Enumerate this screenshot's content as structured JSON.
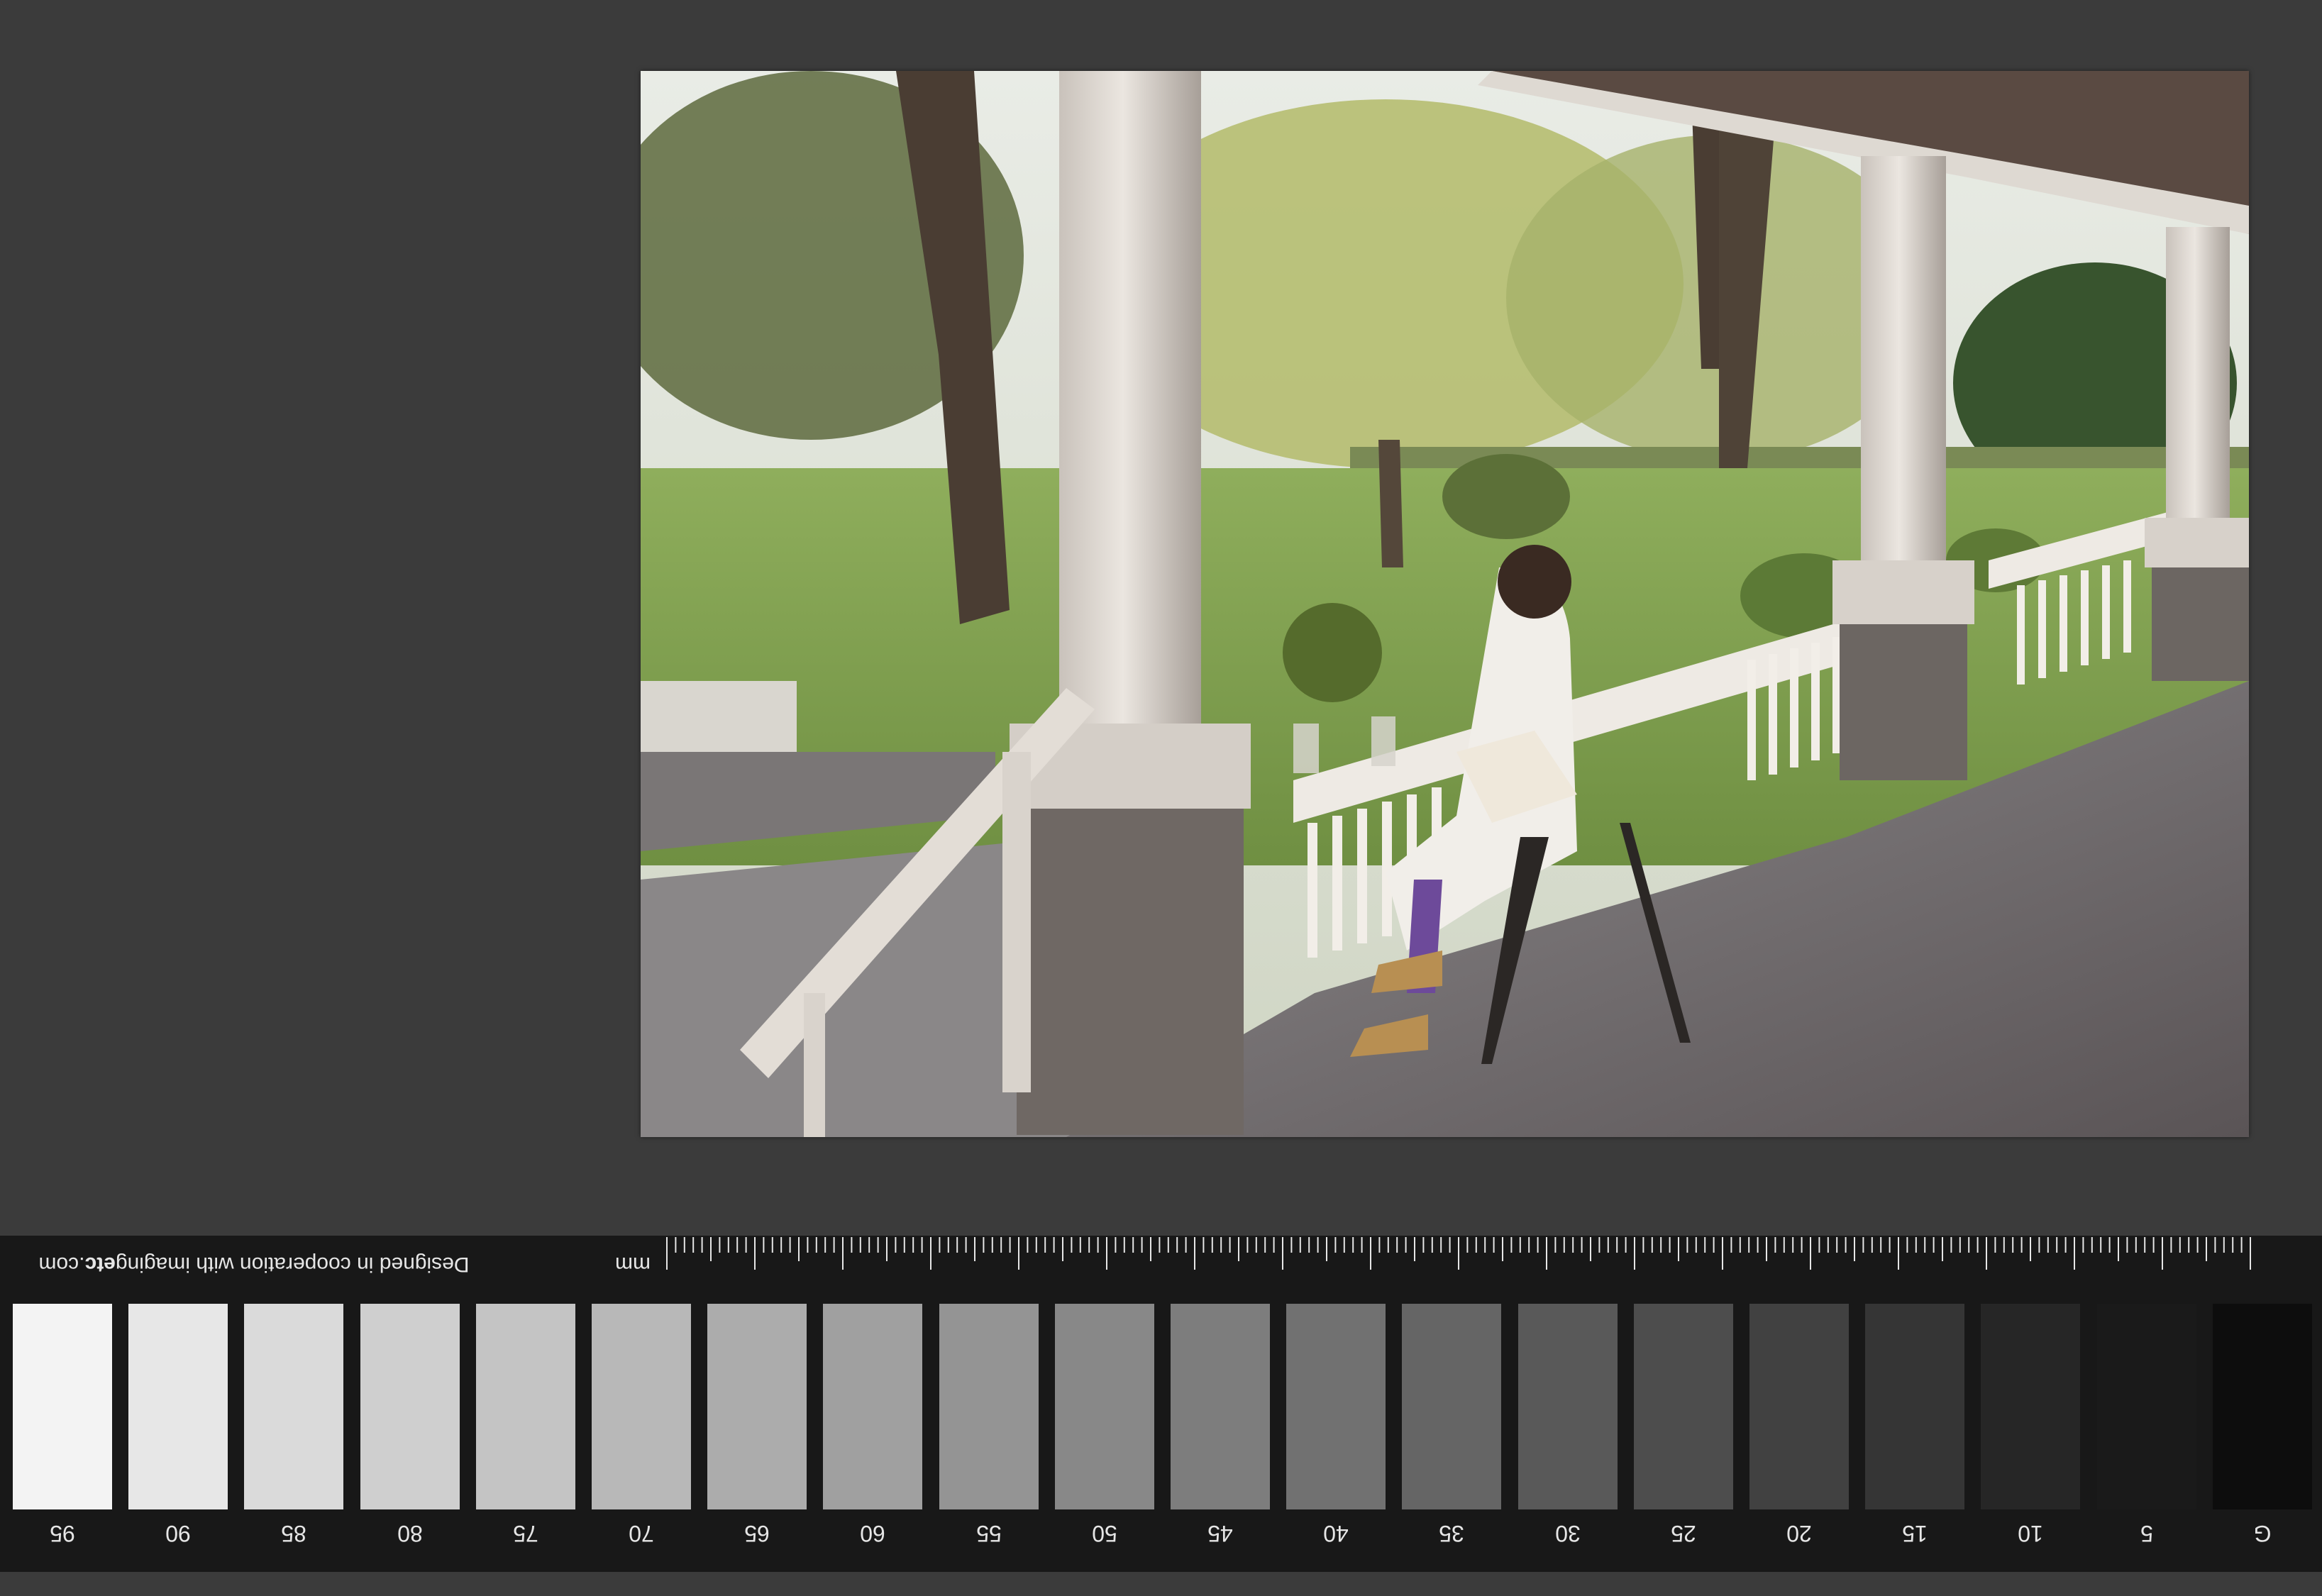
{
  "target": {
    "credit_prefix": "Designed in cooperation with imaging",
    "credit_bold": "etc",
    "credit_suffix": ".com",
    "unit": "mm",
    "patch_labels": [
      "95",
      "90",
      "85",
      "80",
      "75",
      "70",
      "65",
      "60",
      "55",
      "50",
      "45",
      "40",
      "35",
      "30",
      "25",
      "20",
      "15",
      "10",
      "5",
      "G"
    ],
    "patch_colors": [
      "#f3f3f3",
      "#e7e7e7",
      "#dadada",
      "#cfcfcf",
      "#c4c4c4",
      "#b8b8b8",
      "#acacac",
      "#a0a0a0",
      "#949494",
      "#888888",
      "#7d7d7d",
      "#717171",
      "#656565",
      "#595959",
      "#4d4d4d",
      "#414141",
      "#353535",
      "#262626",
      "#1a1a1a",
      "#0d0d0d"
    ]
  }
}
